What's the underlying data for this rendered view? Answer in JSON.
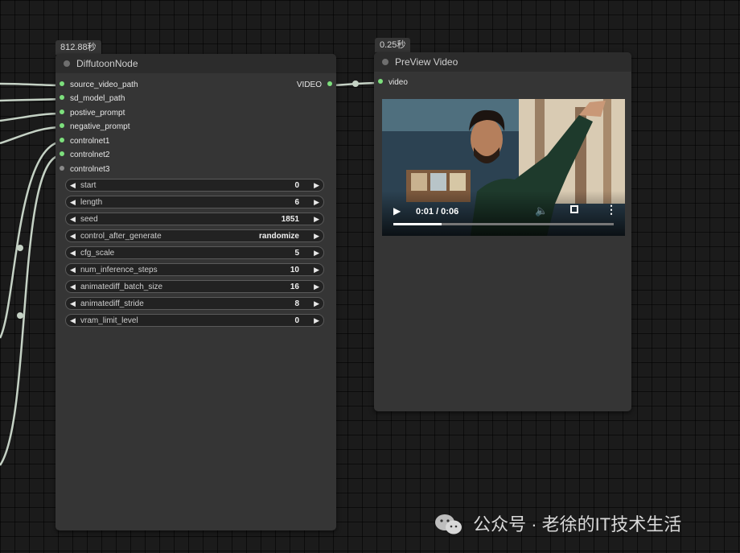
{
  "colors": {
    "canvas_bg": "#1b1b1b",
    "node_bg": "#353535",
    "title_bg": "#2c2c2c",
    "pin_connected": "#7de07d",
    "pin_disconnected": "#8a8a8a",
    "wire": "#c5d2c5"
  },
  "diffutoon_node": {
    "timing": "812.88秒",
    "title": "DiffutoonNode",
    "inputs": [
      "source_video_path",
      "sd_model_path",
      "postive_prompt",
      "negative_prompt",
      "controlnet1",
      "controlnet2",
      "controlnet3"
    ],
    "output": "VIDEO",
    "widgets": [
      {
        "label": "start",
        "value": "0"
      },
      {
        "label": "length",
        "value": "6"
      },
      {
        "label": "seed",
        "value": "1851"
      },
      {
        "label": "control_after_generate",
        "value": "randomize"
      },
      {
        "label": "cfg_scale",
        "value": "5"
      },
      {
        "label": "num_inference_steps",
        "value": "10"
      },
      {
        "label": "animatediff_batch_size",
        "value": "16"
      },
      {
        "label": "animatediff_stride",
        "value": "8"
      },
      {
        "label": "vram_limit_level",
        "value": "0"
      }
    ]
  },
  "preview_node": {
    "timing": "0.25秒",
    "title": "PreView Video",
    "input": "video",
    "player": {
      "time": "0:01 / 0:06",
      "progress": 0.22
    }
  },
  "watermark": "公众号 · 老徐的IT技术生活"
}
